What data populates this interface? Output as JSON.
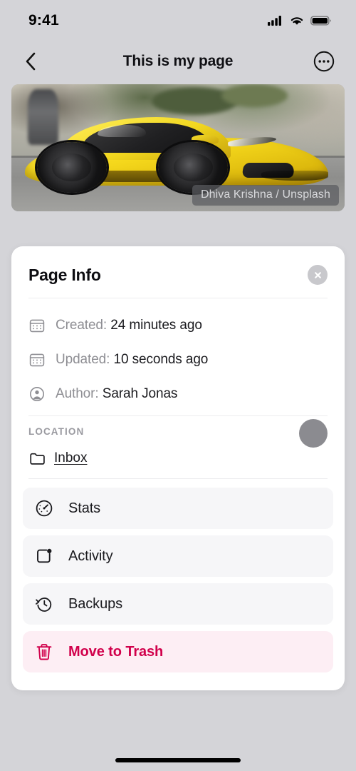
{
  "status_bar": {
    "time": "9:41",
    "icons": [
      "cellular-signal-icon",
      "wifi-icon",
      "battery-icon"
    ]
  },
  "nav": {
    "back_icon": "chevron-left-icon",
    "title": "This is my page",
    "more_icon": "ellipsis-circle-icon"
  },
  "hero": {
    "alt": "yellow sports car parked on street",
    "attribution": "Dhiva Krishna / Unsplash"
  },
  "card": {
    "title": "Page Info",
    "close_icon": "close-icon",
    "meta": [
      {
        "icon": "calendar-icon",
        "label": "Created:",
        "value": "24 minutes ago"
      },
      {
        "icon": "calendar-icon",
        "label": "Updated:",
        "value": "10 seconds ago"
      },
      {
        "icon": "person-circle-icon",
        "label": "Author:",
        "value": "Sarah Jonas"
      }
    ],
    "location": {
      "section_label": "LOCATION",
      "folder_icon": "folder-icon",
      "name": "Inbox",
      "avatar": "site-avatar"
    },
    "actions": [
      {
        "icon": "gauge-icon",
        "label": "Stats"
      },
      {
        "icon": "activity-badge-icon",
        "label": "Activity"
      },
      {
        "icon": "backup-clock-icon",
        "label": "Backups"
      }
    ],
    "destructive_action": {
      "icon": "trash-icon",
      "label": "Move to Trash"
    }
  },
  "colors": {
    "page_background": "#d4d4d8",
    "card_background": "#ffffff",
    "row_background": "#f6f6f8",
    "danger_text": "#d1004b",
    "danger_background": "#fdeef4",
    "muted_text": "#8e8e93"
  }
}
